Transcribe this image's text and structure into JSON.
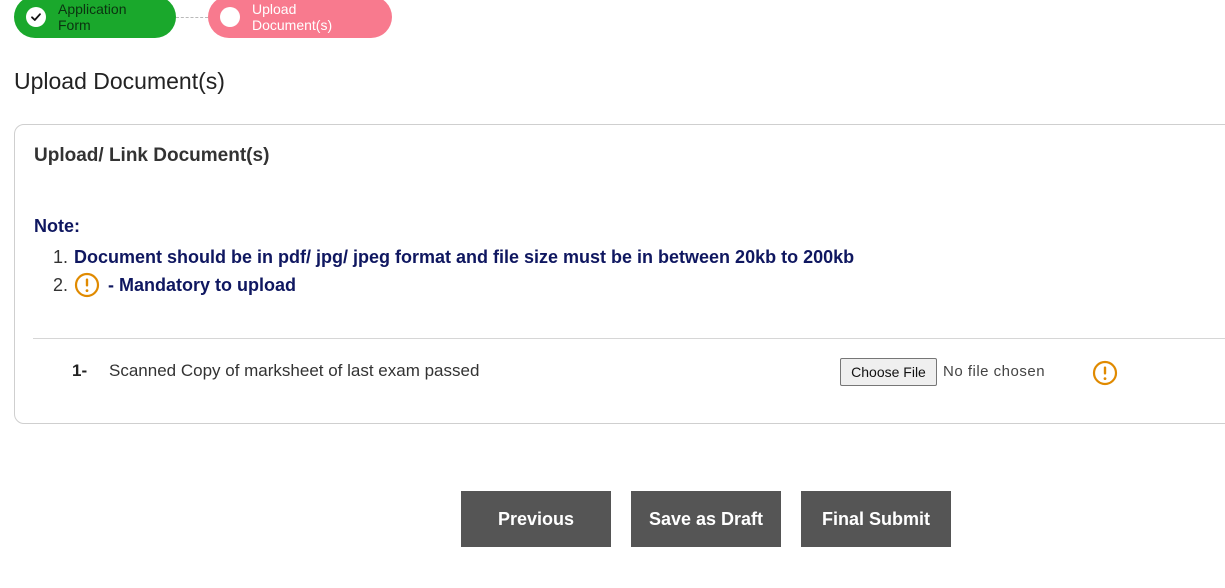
{
  "stepper": {
    "steps": [
      {
        "label": "Application Form",
        "status": "completed"
      },
      {
        "label": "Upload Document(s)",
        "status": "active"
      }
    ]
  },
  "page": {
    "title": "Upload Document(s)"
  },
  "card": {
    "title": "Upload/ Link Document(s)",
    "note_label": "Note:",
    "notes": [
      {
        "number": "1.",
        "text": "Document should be in pdf/ jpg/ jpeg format and file size must be in between 20kb to 200kb"
      },
      {
        "number": "2.",
        "icon": "warning-circle-icon",
        "text": "- Mandatory to upload"
      }
    ]
  },
  "documents": [
    {
      "number": "1-",
      "label": "Scanned Copy of marksheet of last exam passed",
      "file_button": "Choose File",
      "file_status": "No file chosen",
      "mandatory_icon": "warning-circle-icon"
    }
  ],
  "actions": {
    "previous": "Previous",
    "save_draft": "Save as Draft",
    "final_submit": "Final Submit"
  },
  "colors": {
    "step_completed": "#1aa82c",
    "step_active": "#f87a8e",
    "note_text": "#0f1760",
    "warning": "#e08a00",
    "button_bg": "#555555"
  }
}
